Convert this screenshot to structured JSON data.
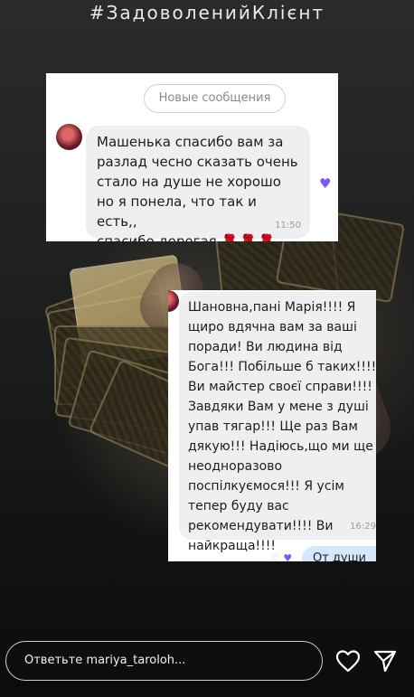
{
  "story": {
    "title": "#ЗадоволенийКлієнт"
  },
  "screenshot1": {
    "new_messages_label": "Новые сообщения",
    "message_lines": [
      "Машенька спасибо вам за",
      "разлад чесно сказать очень",
      "стало на душе не хорошо",
      "но я понела, что так и есть,,",
      "спасибо дорогая"
    ],
    "roses": "🌹🌹🌹",
    "time": "11:50",
    "reaction_icon": "heart-icon",
    "reaction_color": "#7a5af0"
  },
  "screenshot2": {
    "message_lines": [
      "Шановна,пані Марія!!!! Я",
      "щиро вдячна вам за ваші",
      "поради! Ви людина від",
      "Бога!!! Побільше б таких!!!!",
      "Ви майстер своєї справи!!!!",
      "Завдяки Вам у мене з душі",
      "упав тягар!!! Ще раз Вам",
      "дякую!!! Надіюсь,що ми ще",
      "неодноразово",
      "поспілкуємося!!! Я усім",
      "тепер буду вас",
      "рекомендувати!!!! Ви",
      "найкраща!!!!"
    ],
    "time": "16:29",
    "own_reply": "От души"
  },
  "reply_bar": {
    "placeholder": "Ответьте mariya_taroloh...",
    "like_icon": "heart-outline-icon",
    "share_icon": "send-icon"
  },
  "colors": {
    "accent_purple": "#7a5af0",
    "bubble_gray": "#efeff2",
    "own_bubble_blue": "#d6e6fb"
  }
}
